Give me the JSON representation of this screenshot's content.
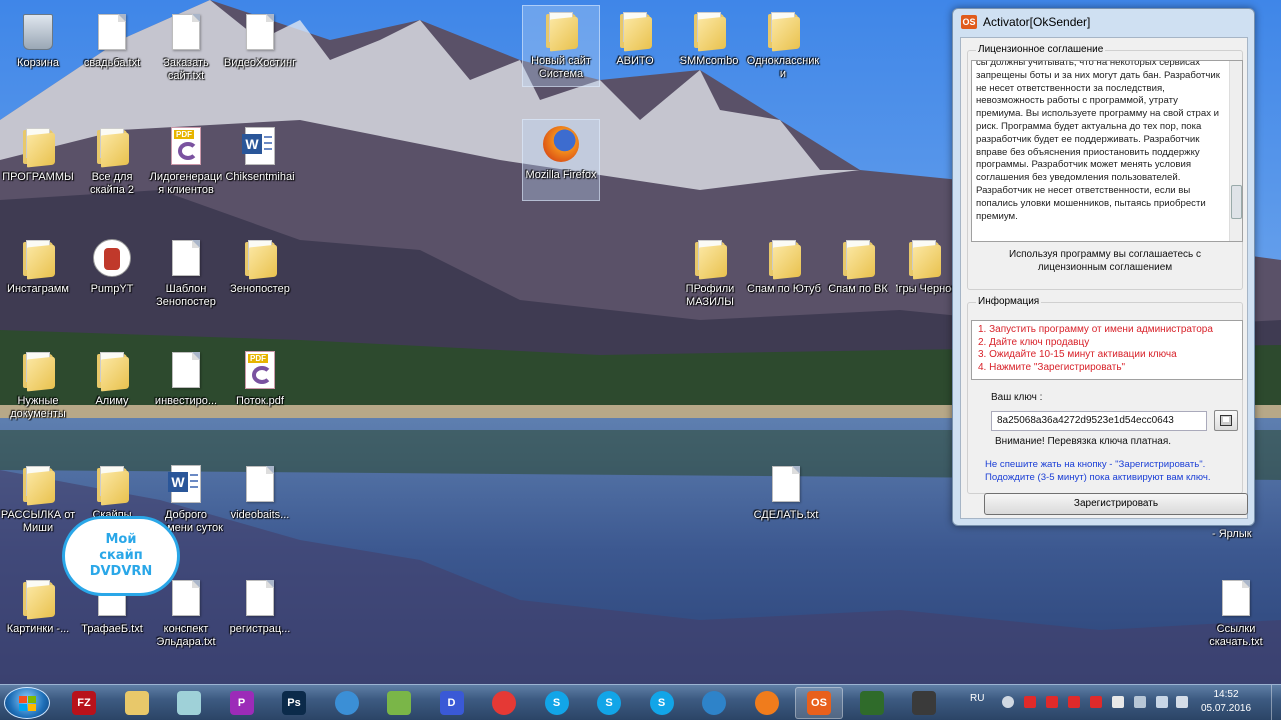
{
  "desktop": {
    "icons": [
      {
        "label": "Корзина",
        "kind": "bin"
      },
      {
        "label": "свадьба.txt",
        "kind": "doc"
      },
      {
        "label": "Заказать сайт.txt",
        "kind": "doc"
      },
      {
        "label": "ВидеоХостинг",
        "kind": "doc"
      },
      {
        "label": "Новый сайт Система",
        "kind": "folder"
      },
      {
        "label": "АВИТО",
        "kind": "folder"
      },
      {
        "label": "SMMcombo",
        "kind": "folder"
      },
      {
        "label": "Одноклассники",
        "kind": "folder"
      },
      {
        "label": "ПРОГРАММЫ",
        "kind": "folder"
      },
      {
        "label": "Все для скайпа 2",
        "kind": "folder"
      },
      {
        "label": "Лидогенерация клиентов",
        "kind": "pdf"
      },
      {
        "label": "Chiksentmihai",
        "kind": "word"
      },
      {
        "label": "Mozilla Firefox",
        "kind": "firefox"
      },
      {
        "label": "Инстаграмм",
        "kind": "folder"
      },
      {
        "label": "PumpYT",
        "kind": "pump"
      },
      {
        "label": "Шаблон Зенопостер",
        "kind": "doc"
      },
      {
        "label": "Зенопостер",
        "kind": "folder"
      },
      {
        "label": "ПРофили МАЗИЛЫ",
        "kind": "folder"
      },
      {
        "label": "Спам по Ютуб",
        "kind": "folder"
      },
      {
        "label": "Спам по ВК",
        "kind": "folder"
      },
      {
        "label": "Игры Черное",
        "kind": "folder"
      },
      {
        "label": "Нужные документы",
        "kind": "folder"
      },
      {
        "label": "Алиму",
        "kind": "folder"
      },
      {
        "label": "инвестиро...",
        "kind": "doc"
      },
      {
        "label": "Поток.pdf",
        "kind": "pdf"
      },
      {
        "label": "РАССЫЛКА от Миши",
        "kind": "folder"
      },
      {
        "label": "Скайпы",
        "kind": "folder"
      },
      {
        "label": "Доброго времени суток",
        "kind": "word"
      },
      {
        "label": "videobaits...",
        "kind": "doc"
      },
      {
        "label": "СДЕЛАТЬ.txt",
        "kind": "doc"
      },
      {
        "label": "- Ярлык",
        "kind": "none"
      },
      {
        "label": "Картинки -...",
        "kind": "folder"
      },
      {
        "label": "ТрафаеБ.txt",
        "kind": "doc"
      },
      {
        "label": "конспект Эльдара.txt",
        "kind": "doc"
      },
      {
        "label": "регистрац...",
        "kind": "doc"
      },
      {
        "label": "Ссылки скачать.txt",
        "kind": "doc"
      }
    ],
    "badge": "Мой\nскайп\nDVDVRN"
  },
  "window": {
    "title": "Activator[OkSender]",
    "license_legend": "Лицензионное соглашение",
    "license_text": "сы должны учитывать, что на некоторых сервисах запрещены боты и за них могут дать бан. Разработчик не несет ответственности за последствия, невозможность работы с программой, утрату премиума. Вы используете программу на свой страх и риск. Программа будет актуальна до тех пор, пока разработчик будет ее поддерживать. Разработчик вправе без объяснения приостановить поддержку программы. Разработчик может менять условия соглашения без уведомления пользователей. Разработчик не несет ответственности, если вы попались уловки мошенников, пытаясь приобрести премиум.",
    "agree_text": "Используя программу вы соглашаетесь с лицензионным соглашением",
    "info_legend": "Информация",
    "info_lines": [
      "1. Запустить программу от имени администратора",
      "2. Дайте ключ продавцу",
      "3. Ожидайте 10-15 минут активации ключа",
      "4. Нажмите \"Зарегистрировать\""
    ],
    "key_label": "Ваш ключ :",
    "key_value": "8a25068a36a4272d9523e1d54ecc0643",
    "key_note": "Внимание! Перевязка ключа платная.",
    "warning": "Не спешите жать на кнопку - \"Зарегистрировать\". Подождите (3-5 минут) пока активируют вам ключ.",
    "register_label": "Зарегистрировать"
  },
  "taskbar": {
    "lang": "RU",
    "time": "14:52",
    "date": "05.07.2016",
    "items": [
      {
        "name": "filezilla",
        "glyph": "FZ",
        "color": "#b8121b"
      },
      {
        "name": "explorer",
        "glyph": "",
        "color": "#e8c86a"
      },
      {
        "name": "notepad",
        "glyph": "",
        "color": "#9fd1d8"
      },
      {
        "name": "picpick",
        "glyph": "P",
        "color": "#9c2bb8"
      },
      {
        "name": "photoshop",
        "glyph": "Ps",
        "color": "#0b2a4a"
      },
      {
        "name": "ie-globe",
        "glyph": "",
        "color": "#3b8fd6"
      },
      {
        "name": "notepad-plus",
        "glyph": "",
        "color": "#7ab648"
      },
      {
        "name": "dlink",
        "glyph": "D",
        "color": "#3a59d6"
      },
      {
        "name": "chrome",
        "glyph": "",
        "color": "#e53935"
      },
      {
        "name": "skype-1",
        "glyph": "S",
        "color": "#12a5e8"
      },
      {
        "name": "skype-2",
        "glyph": "S",
        "color": "#12a5e8"
      },
      {
        "name": "skype-3",
        "glyph": "S",
        "color": "#12a5e8"
      },
      {
        "name": "globe",
        "glyph": "",
        "color": "#2e83c9"
      },
      {
        "name": "firefox",
        "glyph": "",
        "color": "#f07c1c"
      },
      {
        "name": "oksender",
        "glyph": "OS",
        "color": "#e8601c"
      },
      {
        "name": "app-green-1",
        "glyph": "",
        "color": "#2f6b2a"
      },
      {
        "name": "app-green-2",
        "glyph": "",
        "color": "#3a3a3a"
      }
    ]
  }
}
